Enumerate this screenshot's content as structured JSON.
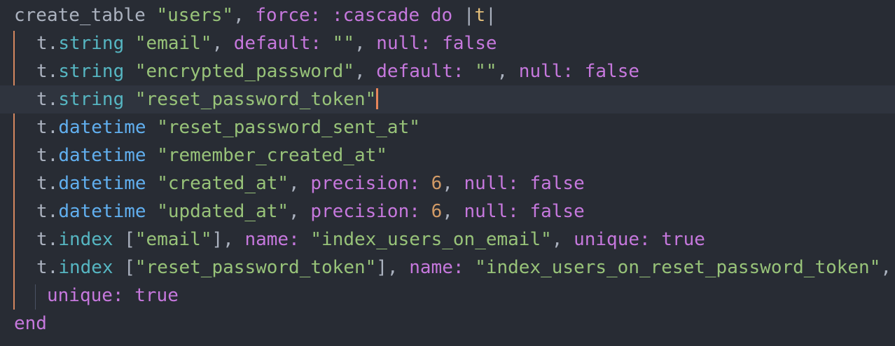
{
  "editor": {
    "cursor_line": 3,
    "colors": {
      "background": "#282c34",
      "active_line": "#2f343e",
      "cursor": "#e8865a",
      "guide_outer": "#d4875f",
      "guide_inner": "#4b5263",
      "plain": "#abb2bf",
      "method_cyan": "#56b6c2",
      "method_blue": "#61afef",
      "string": "#98c379",
      "symbol": "#c678dd",
      "number": "#d19a66",
      "param": "#e5c07b"
    },
    "lines": [
      {
        "indent": 0,
        "tokens": [
          {
            "t": "create_table ",
            "c": "plain"
          },
          {
            "t": "\"users\"",
            "c": "string"
          },
          {
            "t": ", ",
            "c": "punct"
          },
          {
            "t": "force:",
            "c": "symbol"
          },
          {
            "t": " ",
            "c": "plain"
          },
          {
            "t": ":cascade",
            "c": "symbol"
          },
          {
            "t": " ",
            "c": "plain"
          },
          {
            "t": "do",
            "c": "keyword"
          },
          {
            "t": " |",
            "c": "punct"
          },
          {
            "t": "t",
            "c": "param"
          },
          {
            "t": "|",
            "c": "punct"
          }
        ]
      },
      {
        "indent": 1,
        "tokens": [
          {
            "t": "t.",
            "c": "plain"
          },
          {
            "t": "string",
            "c": "method-cyan"
          },
          {
            "t": " ",
            "c": "plain"
          },
          {
            "t": "\"email\"",
            "c": "string"
          },
          {
            "t": ", ",
            "c": "punct"
          },
          {
            "t": "default:",
            "c": "symbol"
          },
          {
            "t": " ",
            "c": "plain"
          },
          {
            "t": "\"\"",
            "c": "string"
          },
          {
            "t": ", ",
            "c": "punct"
          },
          {
            "t": "null:",
            "c": "symbol"
          },
          {
            "t": " ",
            "c": "plain"
          },
          {
            "t": "false",
            "c": "keyword"
          }
        ]
      },
      {
        "indent": 1,
        "tokens": [
          {
            "t": "t.",
            "c": "plain"
          },
          {
            "t": "string",
            "c": "method-cyan"
          },
          {
            "t": " ",
            "c": "plain"
          },
          {
            "t": "\"encrypted_password\"",
            "c": "string"
          },
          {
            "t": ", ",
            "c": "punct"
          },
          {
            "t": "default:",
            "c": "symbol"
          },
          {
            "t": " ",
            "c": "plain"
          },
          {
            "t": "\"\"",
            "c": "string"
          },
          {
            "t": ", ",
            "c": "punct"
          },
          {
            "t": "null:",
            "c": "symbol"
          },
          {
            "t": " ",
            "c": "plain"
          },
          {
            "t": "false",
            "c": "keyword"
          }
        ]
      },
      {
        "indent": 1,
        "tokens": [
          {
            "t": "t.",
            "c": "plain"
          },
          {
            "t": "string",
            "c": "method-cyan"
          },
          {
            "t": " ",
            "c": "plain"
          },
          {
            "t": "\"reset_password_token\"",
            "c": "string"
          }
        ]
      },
      {
        "indent": 1,
        "tokens": [
          {
            "t": "t.",
            "c": "plain"
          },
          {
            "t": "datetime",
            "c": "method-blue"
          },
          {
            "t": " ",
            "c": "plain"
          },
          {
            "t": "\"reset_password_sent_at\"",
            "c": "string"
          }
        ]
      },
      {
        "indent": 1,
        "tokens": [
          {
            "t": "t.",
            "c": "plain"
          },
          {
            "t": "datetime",
            "c": "method-blue"
          },
          {
            "t": " ",
            "c": "plain"
          },
          {
            "t": "\"remember_created_at\"",
            "c": "string"
          }
        ]
      },
      {
        "indent": 1,
        "tokens": [
          {
            "t": "t.",
            "c": "plain"
          },
          {
            "t": "datetime",
            "c": "method-blue"
          },
          {
            "t": " ",
            "c": "plain"
          },
          {
            "t": "\"created_at\"",
            "c": "string"
          },
          {
            "t": ", ",
            "c": "punct"
          },
          {
            "t": "precision:",
            "c": "symbol"
          },
          {
            "t": " ",
            "c": "plain"
          },
          {
            "t": "6",
            "c": "number"
          },
          {
            "t": ", ",
            "c": "punct"
          },
          {
            "t": "null:",
            "c": "symbol"
          },
          {
            "t": " ",
            "c": "plain"
          },
          {
            "t": "false",
            "c": "keyword"
          }
        ]
      },
      {
        "indent": 1,
        "tokens": [
          {
            "t": "t.",
            "c": "plain"
          },
          {
            "t": "datetime",
            "c": "method-blue"
          },
          {
            "t": " ",
            "c": "plain"
          },
          {
            "t": "\"updated_at\"",
            "c": "string"
          },
          {
            "t": ", ",
            "c": "punct"
          },
          {
            "t": "precision:",
            "c": "symbol"
          },
          {
            "t": " ",
            "c": "plain"
          },
          {
            "t": "6",
            "c": "number"
          },
          {
            "t": ", ",
            "c": "punct"
          },
          {
            "t": "null:",
            "c": "symbol"
          },
          {
            "t": " ",
            "c": "plain"
          },
          {
            "t": "false",
            "c": "keyword"
          }
        ]
      },
      {
        "indent": 1,
        "tokens": [
          {
            "t": "t.",
            "c": "plain"
          },
          {
            "t": "index",
            "c": "method-cyan"
          },
          {
            "t": " [",
            "c": "punct"
          },
          {
            "t": "\"email\"",
            "c": "string"
          },
          {
            "t": "], ",
            "c": "punct"
          },
          {
            "t": "name:",
            "c": "symbol"
          },
          {
            "t": " ",
            "c": "plain"
          },
          {
            "t": "\"index_users_on_email\"",
            "c": "string"
          },
          {
            "t": ", ",
            "c": "punct"
          },
          {
            "t": "unique:",
            "c": "symbol"
          },
          {
            "t": " ",
            "c": "plain"
          },
          {
            "t": "true",
            "c": "keyword"
          }
        ]
      },
      {
        "indent": 1,
        "tokens": [
          {
            "t": "t.",
            "c": "plain"
          },
          {
            "t": "index",
            "c": "method-cyan"
          },
          {
            "t": " [",
            "c": "punct"
          },
          {
            "t": "\"reset_password_token\"",
            "c": "string"
          },
          {
            "t": "], ",
            "c": "punct"
          },
          {
            "t": "name:",
            "c": "symbol"
          },
          {
            "t": " ",
            "c": "plain"
          },
          {
            "t": "\"index_users_on_reset_password_token\"",
            "c": "string"
          },
          {
            "t": ",",
            "c": "punct"
          }
        ]
      },
      {
        "indent": 2,
        "tokens": [
          {
            "t": "unique:",
            "c": "symbol"
          },
          {
            "t": " ",
            "c": "plain"
          },
          {
            "t": "true",
            "c": "keyword"
          }
        ]
      },
      {
        "indent": 0,
        "tokens": [
          {
            "t": "end",
            "c": "keyword"
          }
        ]
      }
    ]
  }
}
